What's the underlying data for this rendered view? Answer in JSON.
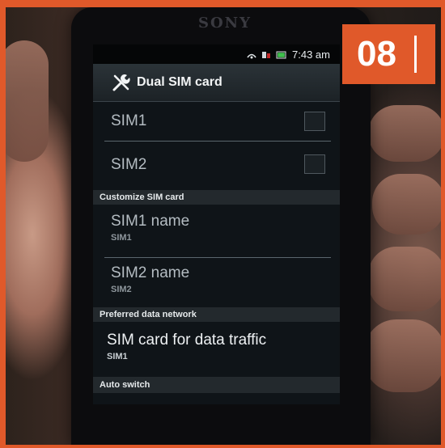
{
  "brand": "SONY",
  "badge": "08",
  "status_bar": {
    "time": "7:43 am"
  },
  "title_bar": {
    "title": "Dual SIM card",
    "icon": "tools-icon"
  },
  "sim_toggles": [
    {
      "label": "SIM1",
      "checked": false
    },
    {
      "label": "SIM2",
      "checked": false
    }
  ],
  "customize_section": {
    "header": "Customize SIM card",
    "items": [
      {
        "label": "SIM1 name",
        "value": "SIM1"
      },
      {
        "label": "SIM2 name",
        "value": "SIM2"
      }
    ]
  },
  "data_section": {
    "header": "Preferred data network",
    "item": {
      "label": "SIM card for data traffic",
      "value": "SIM1"
    }
  },
  "auto_switch_section": {
    "header": "Auto switch"
  },
  "colors": {
    "accent_orange": "#e0592a",
    "screen_bg": "#0f1418"
  }
}
